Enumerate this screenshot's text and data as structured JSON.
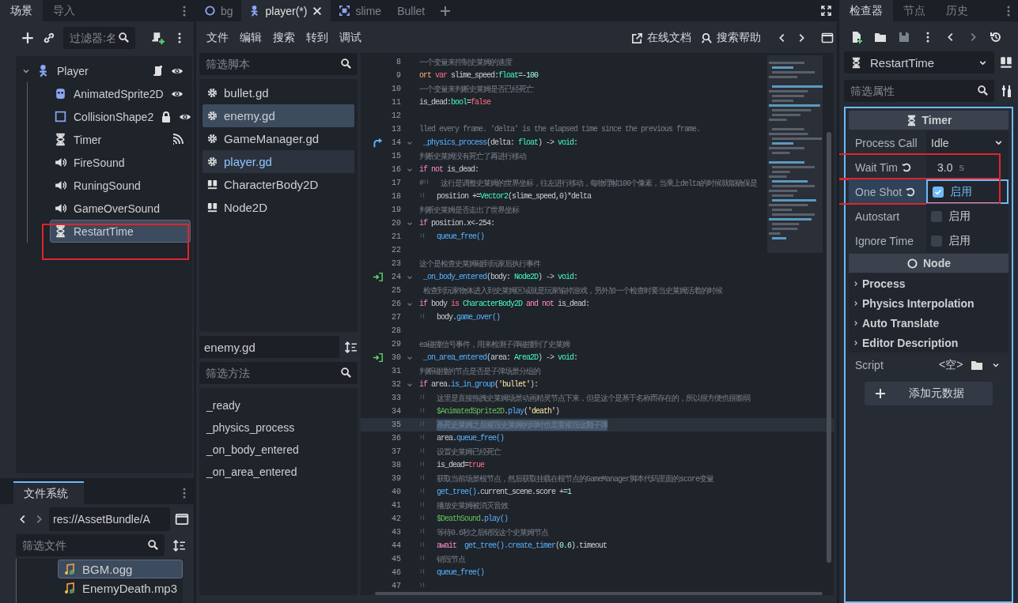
{
  "scene_dock": {
    "tabs": [
      {
        "label": "场景",
        "selected": true
      },
      {
        "label": "导入",
        "selected": false
      }
    ],
    "filter": {
      "placeholder": "过滤器:名"
    },
    "tree": [
      {
        "label": "Player",
        "kind": "character",
        "expanded": true,
        "selected": false,
        "has_script": true,
        "locked": false,
        "has_signals": false,
        "visible": true,
        "children": [
          {
            "label": "AnimatedSprite2D",
            "kind": "sprite",
            "selected": false,
            "has_script": false,
            "locked": false,
            "has_signals": false,
            "visible": true
          },
          {
            "label": "CollisionShape2",
            "kind": "shape",
            "selected": false,
            "has_script": false,
            "locked": true,
            "has_signals": false,
            "visible": true
          },
          {
            "label": "Timer",
            "kind": "timer",
            "selected": false,
            "has_script": false,
            "locked": false,
            "has_signals": true,
            "visible": false
          },
          {
            "label": "FireSound",
            "kind": "audio",
            "selected": false,
            "has_script": false,
            "locked": false,
            "has_signals": false,
            "visible": false
          },
          {
            "label": "RuningSound",
            "kind": "audio",
            "selected": false,
            "has_script": false,
            "locked": false,
            "has_signals": false,
            "visible": false
          },
          {
            "label": "GameOverSound",
            "kind": "audio",
            "selected": false,
            "has_script": false,
            "locked": false,
            "has_signals": false,
            "visible": false
          },
          {
            "label": "RestartTime",
            "kind": "timer",
            "selected": true,
            "annotated": true,
            "has_script": false,
            "locked": false,
            "has_signals": false,
            "visible": false
          }
        ]
      }
    ]
  },
  "filesystem": {
    "tab": "文件系统",
    "path": "res://AssetBundle/A",
    "filter": {
      "placeholder": "筛选文件"
    },
    "files": [
      {
        "label": "BGM.ogg",
        "selected": true
      },
      {
        "label": "EnemyDeath.mp3",
        "selected": false
      }
    ]
  },
  "editor_tabs": [
    {
      "label": "bg",
      "kind": "node",
      "selected": false
    },
    {
      "label": "player(*)",
      "kind": "character",
      "selected": true
    },
    {
      "label": "slime",
      "kind": "frame",
      "selected": false
    },
    {
      "label": "Bullet",
      "kind": "plain",
      "selected": false
    }
  ],
  "menu": [
    "文件",
    "编辑",
    "搜索",
    "转到",
    "调试"
  ],
  "help_buttons": [
    "在线文档",
    "搜索帮助"
  ],
  "scripts": {
    "filter": {
      "placeholder": "筛选脚本"
    },
    "items": [
      {
        "label": "bullet.gd",
        "kind": "script",
        "selected": false,
        "current": false
      },
      {
        "label": "enemy.gd",
        "kind": "script",
        "selected": true,
        "current": false
      },
      {
        "label": "GameManager.gd",
        "kind": "script",
        "selected": false,
        "current": false
      },
      {
        "label": "player.gd",
        "kind": "script",
        "selected": false,
        "current": true
      },
      {
        "label": "CharacterBody2D",
        "kind": "doc",
        "selected": false,
        "current": false
      },
      {
        "label": "Node2D",
        "kind": "doc",
        "selected": false,
        "current": false
      }
    ]
  },
  "current_script": "enemy.gd",
  "methods": {
    "filter": {
      "placeholder": "筛选方法"
    },
    "items": [
      "_ready",
      "_physics_process",
      "_on_body_entered",
      "_on_area_entered"
    ]
  },
  "code": {
    "lines": [
      {
        "number": "8",
        "segs": [
          {
            "kind": "comment",
            "text": "一个变量来控制史莱姆的速度"
          }
        ]
      },
      {
        "number": "9",
        "segs": [
          {
            "kind": "annotation",
            "text": "ort"
          },
          {
            "kind": "keyword",
            "text": " var"
          },
          {
            "kind": "plain",
            "text": " slime_speed:"
          },
          {
            "kind": "type",
            "text": "float"
          },
          {
            "kind": "plain",
            "text": "="
          },
          {
            "kind": "number",
            "text": "-100"
          }
        ]
      },
      {
        "number": "10",
        "segs": [
          {
            "kind": "comment",
            "text": "一个变量来判断史莱姆是否已经死亡"
          }
        ]
      },
      {
        "number": "11",
        "segs": [
          {
            "kind": "plain",
            "text": "is_dead:"
          },
          {
            "kind": "type",
            "text": "bool"
          },
          {
            "kind": "plain",
            "text": "="
          },
          {
            "kind": "keyword",
            "text": "false"
          }
        ]
      },
      {
        "number": "12"
      },
      {
        "number": "13",
        "segs": [
          {
            "kind": "comment",
            "text": "lled every frame. 'delta' is the elapsed time since the previous frame."
          }
        ]
      },
      {
        "number": "14",
        "kind": "override",
        "foldable": true,
        "segs": [
          {
            "kind": "function",
            "text": " _physics_process"
          },
          {
            "kind": "plain",
            "text": "(delta: "
          },
          {
            "kind": "type",
            "text": "float"
          },
          {
            "kind": "plain",
            "text": ") -> "
          },
          {
            "kind": "type",
            "text": "void"
          },
          {
            "kind": "plain",
            "text": ":"
          }
        ]
      },
      {
        "number": "15",
        "segs": [
          {
            "kind": "comment",
            "text": "判断史莱姆没有死亡了再进行移动"
          }
        ]
      },
      {
        "number": "16",
        "foldable": true,
        "segs": [
          {
            "kind": "control",
            "text": "if"
          },
          {
            "kind": "control",
            "text": " not"
          },
          {
            "kind": "plain",
            "text": " is_dead:"
          }
        ]
      },
      {
        "number": "17",
        "segs": [
          {
            "kind": "comment",
            "text": "#"
          },
          {
            "kind": "tab"
          },
          {
            "kind": "comment",
            "text": "这行是调整史莱姆的世界坐标，往左进行移动，每物理帧100个像素，当乘上delta的时候就能确保是"
          }
        ]
      },
      {
        "number": "18",
        "segs": [
          {
            "kind": "tab"
          },
          {
            "kind": "plain",
            "text": "position +="
          },
          {
            "kind": "type",
            "text": "Vector2"
          },
          {
            "kind": "plain",
            "text": "(slime_speed,0)*delta"
          }
        ]
      },
      {
        "number": "19",
        "segs": [
          {
            "kind": "comment",
            "text": "判断史莱姆是否走出了世界坐标"
          }
        ]
      },
      {
        "number": "20",
        "foldable": true,
        "segs": [
          {
            "kind": "control",
            "text": "if"
          },
          {
            "kind": "plain",
            "text": " position.x<-254:"
          }
        ]
      },
      {
        "number": "21",
        "segs": [
          {
            "kind": "tab"
          },
          {
            "kind": "function",
            "text": "queue_free()"
          }
        ]
      },
      {
        "number": "22"
      },
      {
        "number": "23",
        "segs": [
          {
            "kind": "comment",
            "text": "这个是检查史莱姆碰到玩家后执行事件"
          }
        ]
      },
      {
        "number": "24",
        "kind": "signal",
        "foldable": true,
        "segs": [
          {
            "kind": "function",
            "text": " _on_body_entered"
          },
          {
            "kind": "plain",
            "text": "(body: "
          },
          {
            "kind": "type",
            "text": "Node2D"
          },
          {
            "kind": "plain",
            "text": ") -> "
          },
          {
            "kind": "type",
            "text": "void"
          },
          {
            "kind": "plain",
            "text": ":"
          }
        ]
      },
      {
        "number": "25",
        "segs": [
          {
            "kind": "comment",
            "text": " 检查到玩家物体进入到史莱姆区域就是玩家输掉游戏，另外加一个检查时要当史莱姆活着的时候"
          }
        ]
      },
      {
        "number": "26",
        "foldable": true,
        "segs": [
          {
            "kind": "control",
            "text": "if"
          },
          {
            "kind": "plain",
            "text": " body"
          },
          {
            "kind": "keyword",
            "text": " is"
          },
          {
            "kind": "type",
            "text": " CharacterBody2D"
          },
          {
            "kind": "control",
            "text": " and"
          },
          {
            "kind": "control",
            "text": " not"
          },
          {
            "kind": "plain",
            "text": " is_dead:"
          }
        ]
      },
      {
        "number": "27",
        "segs": [
          {
            "kind": "tab"
          },
          {
            "kind": "plain",
            "text": "body."
          },
          {
            "kind": "function",
            "text": "game_over()"
          }
        ]
      },
      {
        "number": "28"
      },
      {
        "number": "29",
        "segs": [
          {
            "kind": "comment",
            "text": "ea碰撞信号事件，用来检测子弹碰撞到了史莱姆"
          }
        ]
      },
      {
        "number": "30",
        "kind": "signal",
        "foldable": true,
        "segs": [
          {
            "kind": "function",
            "text": " _on_area_entered"
          },
          {
            "kind": "plain",
            "text": "(area: "
          },
          {
            "kind": "type",
            "text": "Area2D"
          },
          {
            "kind": "plain",
            "text": ") -> "
          },
          {
            "kind": "type",
            "text": "void"
          },
          {
            "kind": "plain",
            "text": ":"
          }
        ]
      },
      {
        "number": "31",
        "segs": [
          {
            "kind": "comment",
            "text": "判断碰撞的节点是否是子弹场景分组的"
          }
        ]
      },
      {
        "number": "32",
        "foldable": true,
        "segs": [
          {
            "kind": "control",
            "text": "if"
          },
          {
            "kind": "plain",
            "text": " area."
          },
          {
            "kind": "function",
            "text": "is_in_group"
          },
          {
            "kind": "plain",
            "text": "("
          },
          {
            "kind": "string",
            "text": "'bullet'"
          },
          {
            "kind": "plain",
            "text": "):"
          }
        ]
      },
      {
        "number": "33",
        "segs": [
          {
            "kind": "tab"
          },
          {
            "kind": "comment",
            "text": "这里是直接拖拽史莱姆场景动画精灵节点下来，但是这个是基于名称而存在的，所以很方便也很脆弱"
          }
        ]
      },
      {
        "number": "34",
        "segs": [
          {
            "kind": "tab"
          },
          {
            "kind": "nodepath",
            "text": "$AnimatedSprite2D"
          },
          {
            "kind": "plain",
            "text": "."
          },
          {
            "kind": "function",
            "text": "play"
          },
          {
            "kind": "plain",
            "text": "("
          },
          {
            "kind": "string",
            "text": "'death'"
          },
          {
            "kind": "plain",
            "text": ")"
          }
        ]
      },
      {
        "number": "35",
        "highlighted": true,
        "segs": [
          {
            "kind": "tab"
          },
          {
            "kind": "comment",
            "text": "杀死史莱姆之后摧毁史莱姆的同时也需要摧毁这颗子弹"
          }
        ]
      },
      {
        "number": "36",
        "segs": [
          {
            "kind": "tab"
          },
          {
            "kind": "plain",
            "text": "area."
          },
          {
            "kind": "function",
            "text": "queue_free()"
          }
        ]
      },
      {
        "number": "37",
        "segs": [
          {
            "kind": "tab"
          },
          {
            "kind": "comment",
            "text": "设置史莱姆已经死亡"
          }
        ]
      },
      {
        "number": "38",
        "segs": [
          {
            "kind": "tab"
          },
          {
            "kind": "plain",
            "text": "is_dead="
          },
          {
            "kind": "keyword",
            "text": "true"
          }
        ]
      },
      {
        "number": "39",
        "segs": [
          {
            "kind": "tab"
          },
          {
            "kind": "comment",
            "text": "获取当前场景根节点，然后获取挂载在根节点的GameManager脚本代码里面的score变量"
          }
        ]
      },
      {
        "number": "40",
        "segs": [
          {
            "kind": "tab"
          },
          {
            "kind": "function",
            "text": "get_tree()"
          },
          {
            "kind": "plain",
            "text": ".current_scene.score +="
          },
          {
            "kind": "number",
            "text": "1"
          }
        ]
      },
      {
        "number": "41",
        "segs": [
          {
            "kind": "tab"
          },
          {
            "kind": "comment",
            "text": "播放史莱姆被消灭音效"
          }
        ]
      },
      {
        "number": "42",
        "segs": [
          {
            "kind": "tab"
          },
          {
            "kind": "nodepath",
            "text": "$DeathSound"
          },
          {
            "kind": "plain",
            "text": "."
          },
          {
            "kind": "function",
            "text": "play()"
          }
        ]
      },
      {
        "number": "43",
        "segs": [
          {
            "kind": "tab"
          },
          {
            "kind": "comment",
            "text": "等待0.6秒之后销毁这个史莱姆节点"
          }
        ]
      },
      {
        "number": "44",
        "segs": [
          {
            "kind": "tab"
          },
          {
            "kind": "control",
            "text": "await"
          },
          {
            "kind": "function",
            "text": "  get_tree().create_timer"
          },
          {
            "kind": "plain",
            "text": "("
          },
          {
            "kind": "number",
            "text": "0.6"
          },
          {
            "kind": "plain",
            "text": ").timeout"
          }
        ]
      },
      {
        "number": "45",
        "segs": [
          {
            "kind": "tab"
          },
          {
            "kind": "comment",
            "text": "销毁节点"
          }
        ]
      },
      {
        "number": "46",
        "segs": [
          {
            "kind": "tab"
          },
          {
            "kind": "function",
            "text": "queue_free()"
          }
        ]
      },
      {
        "number": "47",
        "segs": [
          {
            "kind": "tab"
          }
        ]
      }
    ]
  },
  "inspector": {
    "tabs": [
      {
        "label": "检查器",
        "selected": true
      },
      {
        "label": "节点",
        "selected": false
      },
      {
        "label": "历史",
        "selected": false
      }
    ],
    "object": "RestartTime",
    "filter": {
      "placeholder": "筛选属性"
    },
    "rows": [
      {
        "kind": "header",
        "label": "Timer"
      },
      {
        "kind": "enum",
        "label": "Process Call",
        "value": "Idle",
        "revertable": false,
        "selected": false,
        "annotated": false
      },
      {
        "kind": "number",
        "label": "Wait Tim",
        "value": "3.0",
        "unit": "s",
        "revertable": true,
        "selected": false,
        "annotated": true
      },
      {
        "kind": "check",
        "label": "One Shot",
        "value": "启用",
        "checked": true,
        "revertable": true,
        "selected": true,
        "annotated": true
      },
      {
        "kind": "check",
        "label": "Autostart",
        "value": "启用",
        "checked": false,
        "revertable": false,
        "selected": false,
        "annotated": false
      },
      {
        "kind": "check",
        "label": "Ignore Time",
        "value": "启用",
        "checked": false,
        "revertable": false,
        "selected": false,
        "annotated": false
      },
      {
        "kind": "header",
        "label": "Node"
      },
      {
        "kind": "group",
        "label": "Process"
      },
      {
        "kind": "group",
        "label": "Physics Interpolation"
      },
      {
        "kind": "group",
        "label": "Auto Translate"
      },
      {
        "kind": "group",
        "label": "Editor Description"
      },
      {
        "kind": "resource",
        "label": "Script",
        "value": "<空>",
        "revertable": false,
        "selected": false,
        "annotated": false
      },
      {
        "kind": "button",
        "label": "添加元数据"
      }
    ]
  }
}
